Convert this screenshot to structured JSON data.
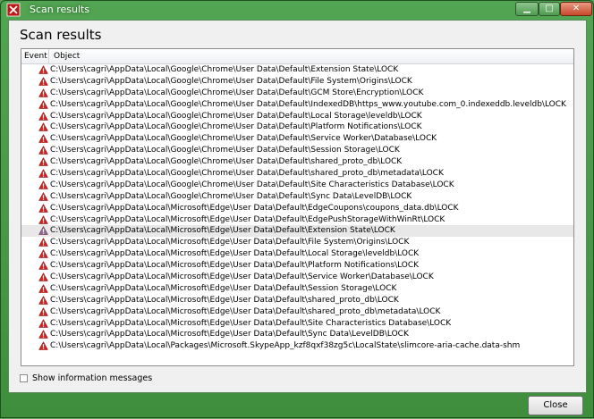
{
  "window": {
    "title": "Scan results"
  },
  "title_buttons": {
    "minimize": "▁",
    "maximize": "□",
    "close": "✕"
  },
  "heading": "Scan results",
  "columns": {
    "event": "Event",
    "object": "Object"
  },
  "rows": [
    "C:\\Users\\cagri\\AppData\\Local\\Google\\Chrome\\User Data\\Default\\Extension State\\LOCK",
    "C:\\Users\\cagri\\AppData\\Local\\Google\\Chrome\\User Data\\Default\\File System\\Origins\\LOCK",
    "C:\\Users\\cagri\\AppData\\Local\\Google\\Chrome\\User Data\\Default\\GCM Store\\Encryption\\LOCK",
    "C:\\Users\\cagri\\AppData\\Local\\Google\\Chrome\\User Data\\Default\\IndexedDB\\https_www.youtube.com_0.indexeddb.leveldb\\LOCK",
    "C:\\Users\\cagri\\AppData\\Local\\Google\\Chrome\\User Data\\Default\\Local Storage\\leveldb\\LOCK",
    "C:\\Users\\cagri\\AppData\\Local\\Google\\Chrome\\User Data\\Default\\Platform Notifications\\LOCK",
    "C:\\Users\\cagri\\AppData\\Local\\Google\\Chrome\\User Data\\Default\\Service Worker\\Database\\LOCK",
    "C:\\Users\\cagri\\AppData\\Local\\Google\\Chrome\\User Data\\Default\\Session Storage\\LOCK",
    "C:\\Users\\cagri\\AppData\\Local\\Google\\Chrome\\User Data\\Default\\shared_proto_db\\LOCK",
    "C:\\Users\\cagri\\AppData\\Local\\Google\\Chrome\\User Data\\Default\\shared_proto_db\\metadata\\LOCK",
    "C:\\Users\\cagri\\AppData\\Local\\Google\\Chrome\\User Data\\Default\\Site Characteristics Database\\LOCK",
    "C:\\Users\\cagri\\AppData\\Local\\Google\\Chrome\\User Data\\Default\\Sync Data\\LevelDB\\LOCK",
    "C:\\Users\\cagri\\AppData\\Local\\Microsoft\\Edge\\User Data\\Default\\EdgeCoupons\\coupons_data.db\\LOCK",
    "C:\\Users\\cagri\\AppData\\Local\\Microsoft\\Edge\\User Data\\Default\\EdgePushStorageWithWinRt\\LOCK",
    "C:\\Users\\cagri\\AppData\\Local\\Microsoft\\Edge\\User Data\\Default\\Extension State\\LOCK",
    "C:\\Users\\cagri\\AppData\\Local\\Microsoft\\Edge\\User Data\\Default\\File System\\Origins\\LOCK",
    "C:\\Users\\cagri\\AppData\\Local\\Microsoft\\Edge\\User Data\\Default\\Local Storage\\leveldb\\LOCK",
    "C:\\Users\\cagri\\AppData\\Local\\Microsoft\\Edge\\User Data\\Default\\Platform Notifications\\LOCK",
    "C:\\Users\\cagri\\AppData\\Local\\Microsoft\\Edge\\User Data\\Default\\Service Worker\\Database\\LOCK",
    "C:\\Users\\cagri\\AppData\\Local\\Microsoft\\Edge\\User Data\\Default\\Session Storage\\LOCK",
    "C:\\Users\\cagri\\AppData\\Local\\Microsoft\\Edge\\User Data\\Default\\shared_proto_db\\LOCK",
    "C:\\Users\\cagri\\AppData\\Local\\Microsoft\\Edge\\User Data\\Default\\shared_proto_db\\metadata\\LOCK",
    "C:\\Users\\cagri\\AppData\\Local\\Microsoft\\Edge\\User Data\\Default\\Site Characteristics Database\\LOCK",
    "C:\\Users\\cagri\\AppData\\Local\\Microsoft\\Edge\\User Data\\Default\\Sync Data\\LevelDB\\LOCK",
    "C:\\Users\\cagri\\AppData\\Local\\Packages\\Microsoft.SkypeApp_kzf8qxf38zg5c\\LocalState\\slimcore-aria-cache.data-shm"
  ],
  "event_icon": "warning-triangle-icon",
  "hovered_row": 14,
  "colors": {
    "frame": "#4a9a4a",
    "warning": "#d22020",
    "hover_row": "#e8e8e8"
  },
  "show_info": {
    "label": "Show information messages",
    "checked": false
  },
  "close_button": {
    "label": "Close"
  }
}
